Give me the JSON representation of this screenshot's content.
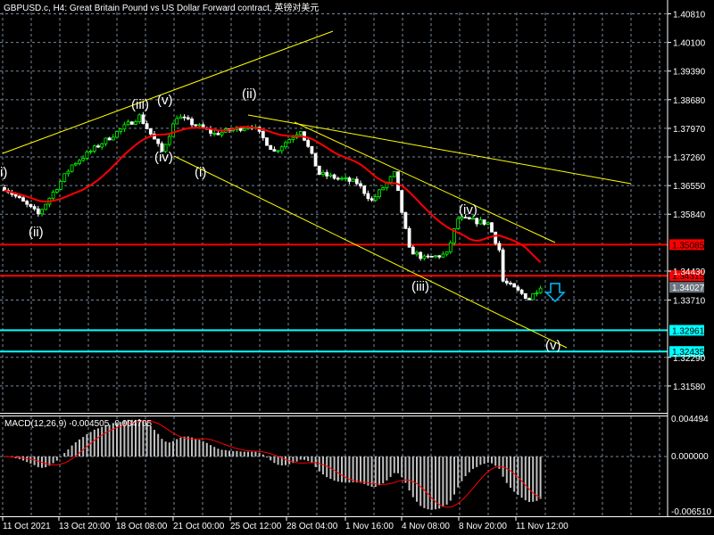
{
  "header": {
    "title": "GBPUSD.c, H4:  Great Britain Pound vs US Dollar Forward contract, 英镑对美元"
  },
  "chart_data": {
    "type": "candlestick",
    "symbol": "GBPUSD.c",
    "timeframe": "H4",
    "bars": 144,
    "price_path": [
      [
        0,
        1.365
      ],
      [
        9,
        1.3584
      ],
      [
        18,
        1.3706
      ],
      [
        26,
        1.3761
      ],
      [
        36,
        1.3827
      ],
      [
        42,
        1.3739
      ],
      [
        46,
        1.3827
      ],
      [
        56,
        1.3783
      ],
      [
        66,
        1.3805
      ],
      [
        72,
        1.3739
      ],
      [
        79,
        1.3794
      ],
      [
        84,
        1.3684
      ],
      [
        94,
        1.3662
      ],
      [
        98,
        1.3617
      ],
      [
        104,
        1.3684
      ],
      [
        108,
        1.3496
      ],
      [
        112,
        1.3474
      ],
      [
        118,
        1.3485
      ],
      [
        121,
        1.3573
      ],
      [
        129,
        1.3562
      ],
      [
        132,
        1.3496
      ],
      [
        133,
        1.3418
      ],
      [
        140,
        1.3374
      ],
      [
        143,
        1.3407
      ]
    ],
    "ylim": [
      1.3109,
      1.4115
    ],
    "y_ticks": [
      "1.40810",
      "1.40100",
      "1.39390",
      "1.38680",
      "1.37970",
      "1.37260",
      "1.36550",
      "1.35840",
      "1.34430",
      "1.33710",
      "1.32290",
      "1.31580"
    ],
    "x_ticks": [
      "11 Oct 2021",
      "13 Oct 20:00",
      "18 Oct 08:00",
      "21 Oct 00:00",
      "25 Oct 12:00",
      "28 Oct 04:00",
      "1 Nov 16:00",
      "4 Nov 08:00",
      "8 Nov 20:00",
      "11 Nov 12:00"
    ],
    "moving_average_period": 20,
    "levels": [
      {
        "price": 1.35085,
        "label": "1.35085",
        "color": "#ff0000"
      },
      {
        "price": 1.34315,
        "label": "1.34315",
        "color": "#ff0000"
      },
      {
        "price": 1.32961,
        "label": "1.32961",
        "color": "#00ffff"
      },
      {
        "price": 1.32435,
        "label": "1.32435",
        "color": "#00ffff"
      }
    ],
    "current_price": {
      "price": 1.34027,
      "label": "1.34027",
      "color": "#6b7580"
    },
    "wave_labels": [
      "i)",
      "(ii)",
      "(iii)",
      "(v)",
      "(iv)",
      "(i)",
      "(ii)",
      "(iii)",
      "(iv)",
      "(v)"
    ],
    "macd": {
      "label": "MACD(12,26,9) -0.004505 -0.004705",
      "ylim": [
        -0.00651,
        0.004494
      ],
      "y_ticks": [
        "0.004494",
        "0.000000",
        "-0.006510"
      ]
    }
  },
  "colors": {
    "bull": "#00ff00",
    "bear": "#ffffff",
    "ma": "#ff0000",
    "trendline": "#ffff00",
    "grid": "#778899",
    "histogram": "#c0c0c0",
    "signal": "#ff0000",
    "arrow": "#00bfff"
  }
}
